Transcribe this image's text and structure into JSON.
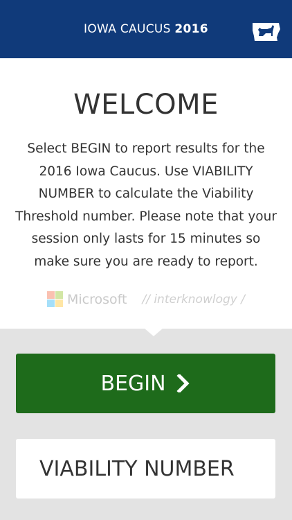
{
  "header": {
    "title_prefix": "IOWA CAUCUS",
    "title_year": "2016",
    "icon": "iowa-donkey-icon"
  },
  "welcome": {
    "heading": "WELCOME",
    "body": "Select BEGIN to report results for the 2016 Iowa Caucus. Use VIABILITY NUMBER to calculate the Viability Threshold number. Please note that your session only lasts for 15 minutes so make sure you are ready to report."
  },
  "partners": {
    "microsoft": "Microsoft",
    "interknowlogy": "// interknowlogy /"
  },
  "actions": {
    "begin_label": "BEGIN",
    "viability_label": "VIABILITY NUMBER"
  },
  "colors": {
    "header_bg": "#103a7a",
    "begin_bg": "#1e6b1b",
    "panel_bg": "#e3e3e3"
  }
}
